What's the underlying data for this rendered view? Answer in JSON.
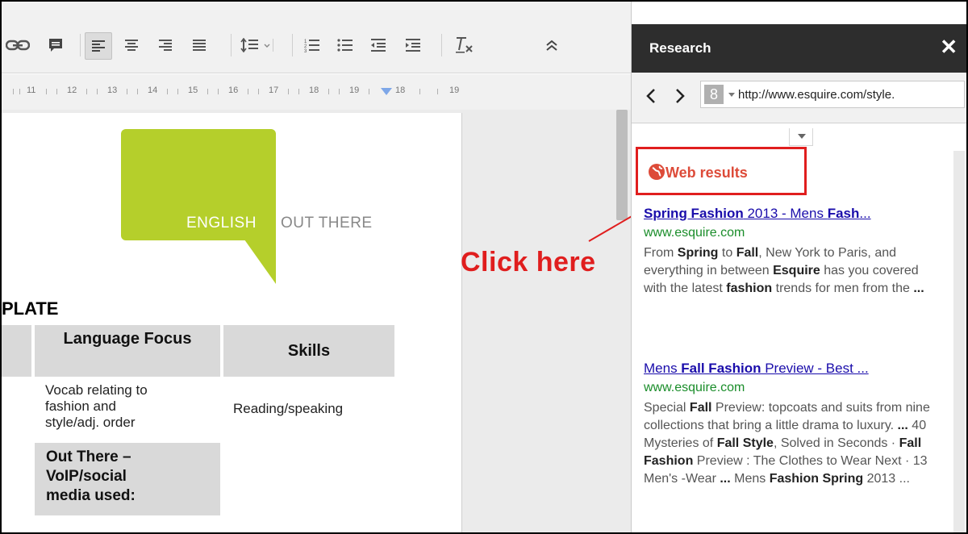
{
  "toolbar": {
    "buttons": [
      "link-icon",
      "comment-icon",
      "align-left-icon",
      "align-center-icon",
      "align-right-icon",
      "align-justify-icon",
      "line-spacing-icon",
      "numbered-list-icon",
      "bulleted-list-icon",
      "decrease-indent-icon",
      "increase-indent-icon",
      "clear-formatting-icon",
      "collapse-toolbar-icon"
    ]
  },
  "ruler": {
    "numbers": [
      "11",
      "12",
      "13",
      "14",
      "15",
      "16",
      "17",
      "18",
      "19"
    ]
  },
  "document": {
    "logo_word1": "ENGLISH",
    "logo_word2": "OUT THERE",
    "heading": "PLATE",
    "table": {
      "col_language_focus": "Language Focus",
      "col_skills": "Skills",
      "language_line1": "Vocab relating to",
      "language_line2": "fashion and",
      "language_line3": "style/adj. order",
      "skills_value": "Reading/speaking",
      "out_there_line1": "Out There –",
      "out_there_line2": "VoIP/social",
      "out_there_line3": "media used:"
    }
  },
  "callout": {
    "text": "Click here",
    "color": "#e01e1e"
  },
  "research": {
    "title": "Research",
    "close_label": "✕",
    "url": "http://www.esquire.com/style.",
    "search_icon_letter": "8",
    "web_results_label": "Web results",
    "results": [
      {
        "title_parts": [
          {
            "text": "Spring Fashion",
            "bold": true
          },
          {
            "text": " 2013 - Mens ",
            "bold": false
          },
          {
            "text": "Fash",
            "bold": true
          },
          {
            "text": "...",
            "bold": false
          }
        ],
        "url": "www.esquire.com",
        "snippet_parts": [
          {
            "text": "From ",
            "bold": false
          },
          {
            "text": "Spring",
            "bold": true
          },
          {
            "text": " to ",
            "bold": false
          },
          {
            "text": "Fall",
            "bold": true
          },
          {
            "text": ", New York to Paris, and everything in between ",
            "bold": false
          },
          {
            "text": "Esquire",
            "bold": true
          },
          {
            "text": " has you covered with the latest ",
            "bold": false
          },
          {
            "text": "fashion",
            "bold": true
          },
          {
            "text": " trends for men from the ",
            "bold": false
          },
          {
            "text": "...",
            "bold": true
          }
        ]
      },
      {
        "title_parts": [
          {
            "text": "Mens ",
            "bold": false
          },
          {
            "text": "Fall Fashion",
            "bold": true
          },
          {
            "text": " Preview - Best ...",
            "bold": false
          }
        ],
        "url": "www.esquire.com",
        "snippet_parts": [
          {
            "text": "Special ",
            "bold": false
          },
          {
            "text": "Fall",
            "bold": true
          },
          {
            "text": " Preview: topcoats and suits from nine collections that bring a little drama to luxury. ",
            "bold": false
          },
          {
            "text": "...",
            "bold": true
          },
          {
            "text": " 40 Mysteries of ",
            "bold": false
          },
          {
            "text": "Fall Style",
            "bold": true
          },
          {
            "text": ", Solved in Seconds · ",
            "bold": false
          },
          {
            "text": "Fall Fashion",
            "bold": true
          },
          {
            "text": " Preview : The Clothes to Wear Next · 13 Men's -Wear ",
            "bold": false
          },
          {
            "text": "...",
            "bold": true
          },
          {
            "text": " Mens ",
            "bold": false
          },
          {
            "text": "Fashion Spring",
            "bold": true
          },
          {
            "text": " 2013 ...",
            "bold": false
          }
        ]
      }
    ]
  },
  "colors": {
    "logo_green": "#b5cf2b",
    "link_blue": "#1a0dab",
    "url_green": "#1a8d2a",
    "web_results_red": "#dd4b39"
  }
}
